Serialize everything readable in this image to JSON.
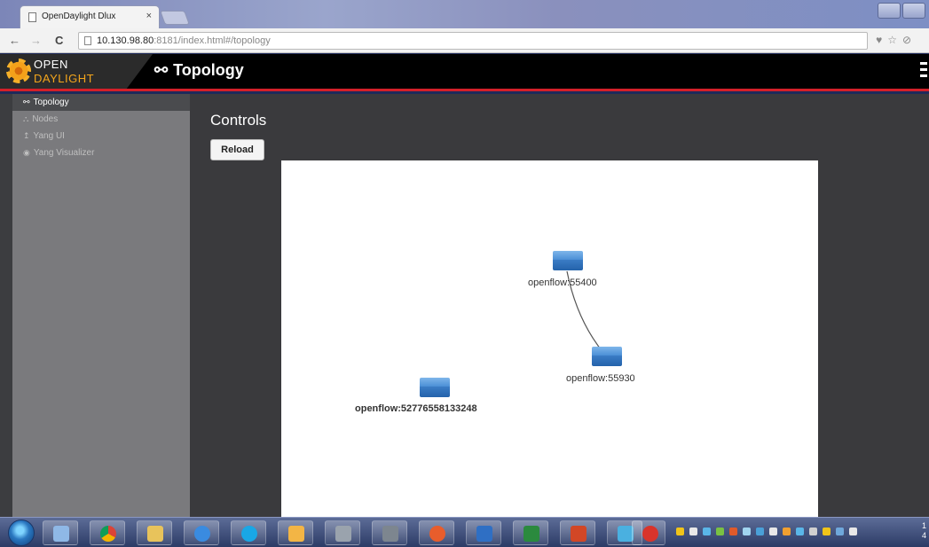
{
  "browser": {
    "tab_title": "OpenDaylight Dlux",
    "tab_close": "×",
    "url_host": "10.130.98.80",
    "url_rest": ":8181/index.html#/topology",
    "back": "←",
    "forward": "→",
    "reload": "C",
    "toolbar_icons": "♥☆⊘"
  },
  "header": {
    "brand_line1": "OPEN",
    "brand_line2": "DAYLIGHT",
    "page_title": "Topology",
    "page_icon": "⚯"
  },
  "sidebar": {
    "items": [
      {
        "label": "Topology",
        "icon": "⚯",
        "icon_name": "topology-icon",
        "active": true
      },
      {
        "label": "Nodes",
        "icon": "⛬",
        "icon_name": "sitemap-icon",
        "active": false
      },
      {
        "label": "Yang UI",
        "icon": "↥",
        "icon_name": "level-down-icon",
        "active": false
      },
      {
        "label": "Yang Visualizer",
        "icon": "◉",
        "icon_name": "eye-icon",
        "active": false
      }
    ]
  },
  "main": {
    "controls_title": "Controls",
    "reload_label": "Reload"
  },
  "topology": {
    "nodes": [
      {
        "id": "openflow:55400",
        "label": "openflow:55400",
        "bold": false
      },
      {
        "id": "openflow:55930",
        "label": "openflow:55930",
        "bold": false
      },
      {
        "id": "openflow:52776558133248",
        "label": "openflow:52776558133248",
        "bold": true
      }
    ],
    "links": [
      {
        "source": "openflow:55400",
        "target": "openflow:55930"
      }
    ]
  },
  "taskbar": {
    "clock_line1": "1",
    "clock_line2": "4"
  },
  "colors": {
    "accent_red": "#d42029",
    "brand_orange": "#f3a51c",
    "switch_blue": "#3b7cc5"
  }
}
